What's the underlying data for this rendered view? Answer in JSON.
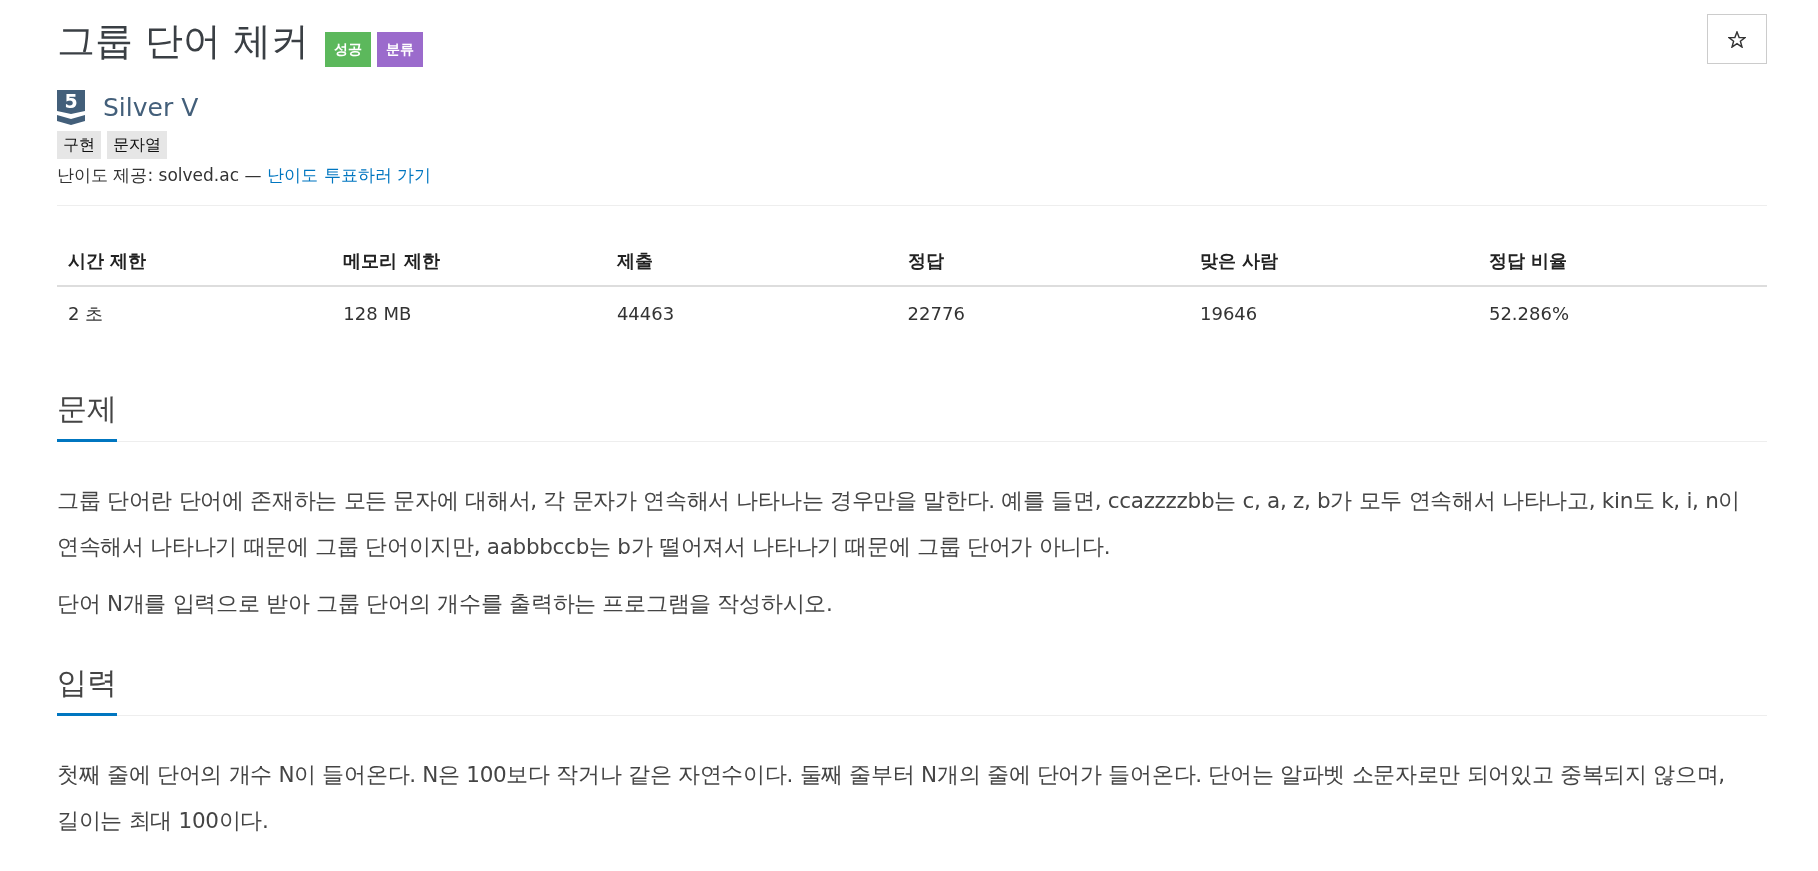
{
  "problem": {
    "title": "그룹 단어 체커",
    "badges": [
      {
        "label": "성공",
        "color": "#5cb85c"
      },
      {
        "label": "분류",
        "color": "#9b6bcc"
      }
    ]
  },
  "favorite": {
    "starred": false
  },
  "tier": {
    "level": "5",
    "name": "Silver V"
  },
  "tags": [
    "구현",
    "문자열"
  ],
  "difficulty": {
    "credit": "난이도 제공: solved.ac —",
    "vote_link": "난이도 투표하러 가기"
  },
  "stats": {
    "columns": [
      "시간 제한",
      "메모리 제한",
      "제출",
      "정답",
      "맞은 사람",
      "정답 비율"
    ],
    "rows": [
      [
        "2 초",
        "128 MB",
        "44463",
        "22776",
        "19646",
        "52.286%"
      ]
    ]
  },
  "sections": [
    {
      "title": "문제",
      "paragraphs": [
        "그룹 단어란 단어에 존재하는 모든 문자에 대해서, 각 문자가 연속해서 나타나는 경우만을 말한다. 예를 들면, ccazzzzbb는 c, a, z, b가 모두 연속해서 나타나고, kin도 k, i, n이 연속해서 나타나기 때문에 그룹 단어이지만, aabbbccb는 b가 떨어져서 나타나기 때문에 그룹 단어가 아니다.",
        "단어 N개를 입력으로 받아 그룹 단어의 개수를 출력하는 프로그램을 작성하시오."
      ]
    },
    {
      "title": "입력",
      "paragraphs": [
        "첫째 줄에 단어의 개수 N이 들어온다. N은 100보다 작거나 같은 자연수이다. 둘째 줄부터 N개의 줄에 단어가 들어온다. 단어는 알파벳 소문자로만 되어있고 중복되지 않으며, 길이는 최대 100이다."
      ]
    }
  ]
}
